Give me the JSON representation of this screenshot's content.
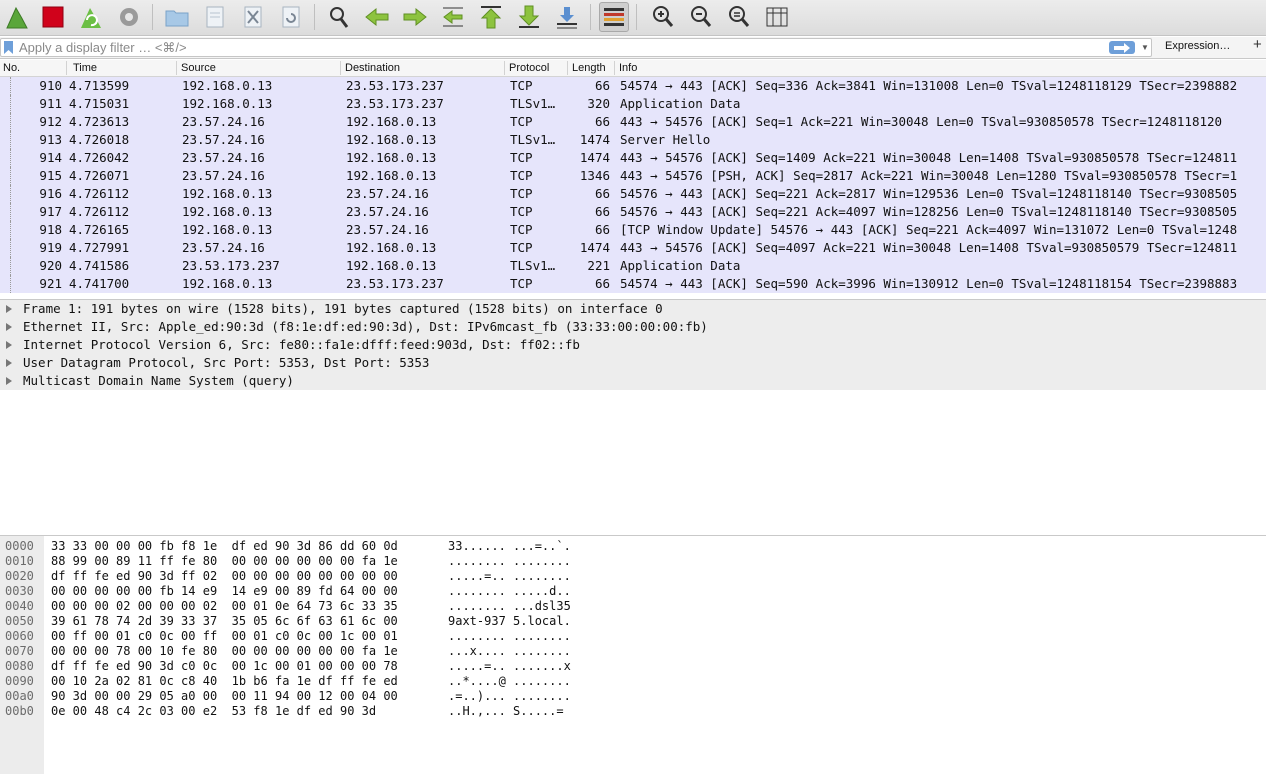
{
  "toolbar": {
    "buttons": [
      {
        "name": "start-capture-fin-icon"
      },
      {
        "name": "stop-capture-icon"
      },
      {
        "name": "restart-capture-icon"
      },
      {
        "name": "capture-options-gear-icon"
      },
      {
        "name": "open-file-folder-icon"
      },
      {
        "name": "save-file-icon"
      },
      {
        "name": "close-file-icon"
      },
      {
        "name": "reload-file-icon"
      },
      {
        "name": "find-packet-magnifier-icon"
      },
      {
        "name": "go-back-arrow-icon"
      },
      {
        "name": "go-forward-arrow-icon"
      },
      {
        "name": "go-to-packet-icon"
      },
      {
        "name": "go-to-first-packet-icon"
      },
      {
        "name": "go-to-last-packet-icon"
      },
      {
        "name": "autoscroll-icon"
      },
      {
        "name": "colorize-icon"
      },
      {
        "name": "zoom-in-icon"
      },
      {
        "name": "zoom-out-icon"
      },
      {
        "name": "normal-size-icon"
      },
      {
        "name": "resize-columns-icon"
      }
    ],
    "colors": {
      "fin": "#5aa63a",
      "stop": "#d0021b",
      "arrow_green": "#8dc33f",
      "zoom": "#3a3a3a"
    }
  },
  "filter": {
    "placeholder": "Apply a display filter … <⌘/>",
    "expression_label": "Expression…",
    "plus_label": "+",
    "apply_color": "#6e9fd9"
  },
  "packet_list": {
    "columns": {
      "no": "No.",
      "time": "Time",
      "source": "Source",
      "destination": "Destination",
      "protocol": "Protocol",
      "length": "Length",
      "info": "Info"
    },
    "row_color": "#e6e5fb",
    "rows": [
      {
        "no": "910",
        "time": "4.713599",
        "src": "192.168.0.13",
        "dst": "23.53.173.237",
        "proto": "TCP",
        "len": "66",
        "info": "54574 → 443 [ACK] Seq=336 Ack=3841 Win=131008 Len=0 TSval=1248118129 TSecr=2398882"
      },
      {
        "no": "911",
        "time": "4.715031",
        "src": "192.168.0.13",
        "dst": "23.53.173.237",
        "proto": "TLSv1…",
        "len": "320",
        "info": "Application Data"
      },
      {
        "no": "912",
        "time": "4.723613",
        "src": "23.57.24.16",
        "dst": "192.168.0.13",
        "proto": "TCP",
        "len": "66",
        "info": "443 → 54576 [ACK] Seq=1 Ack=221 Win=30048 Len=0 TSval=930850578 TSecr=1248118120"
      },
      {
        "no": "913",
        "time": "4.726018",
        "src": "23.57.24.16",
        "dst": "192.168.0.13",
        "proto": "TLSv1…",
        "len": "1474",
        "info": "Server Hello"
      },
      {
        "no": "914",
        "time": "4.726042",
        "src": "23.57.24.16",
        "dst": "192.168.0.13",
        "proto": "TCP",
        "len": "1474",
        "info": "443 → 54576 [ACK] Seq=1409 Ack=221 Win=30048 Len=1408 TSval=930850578 TSecr=124811"
      },
      {
        "no": "915",
        "time": "4.726071",
        "src": "23.57.24.16",
        "dst": "192.168.0.13",
        "proto": "TCP",
        "len": "1346",
        "info": "443 → 54576 [PSH, ACK] Seq=2817 Ack=221 Win=30048 Len=1280 TSval=930850578 TSecr=1"
      },
      {
        "no": "916",
        "time": "4.726112",
        "src": "192.168.0.13",
        "dst": "23.57.24.16",
        "proto": "TCP",
        "len": "66",
        "info": "54576 → 443 [ACK] Seq=221 Ack=2817 Win=129536 Len=0 TSval=1248118140 TSecr=9308505"
      },
      {
        "no": "917",
        "time": "4.726112",
        "src": "192.168.0.13",
        "dst": "23.57.24.16",
        "proto": "TCP",
        "len": "66",
        "info": "54576 → 443 [ACK] Seq=221 Ack=4097 Win=128256 Len=0 TSval=1248118140 TSecr=9308505"
      },
      {
        "no": "918",
        "time": "4.726165",
        "src": "192.168.0.13",
        "dst": "23.57.24.16",
        "proto": "TCP",
        "len": "66",
        "info": "[TCP Window Update] 54576 → 443 [ACK] Seq=221 Ack=4097 Win=131072 Len=0 TSval=1248"
      },
      {
        "no": "919",
        "time": "4.727991",
        "src": "23.57.24.16",
        "dst": "192.168.0.13",
        "proto": "TCP",
        "len": "1474",
        "info": "443 → 54576 [ACK] Seq=4097 Ack=221 Win=30048 Len=1408 TSval=930850579 TSecr=124811"
      },
      {
        "no": "920",
        "time": "4.741586",
        "src": "23.53.173.237",
        "dst": "192.168.0.13",
        "proto": "TLSv1…",
        "len": "221",
        "info": "Application Data"
      },
      {
        "no": "921",
        "time": "4.741700",
        "src": "192.168.0.13",
        "dst": "23.53.173.237",
        "proto": "TCP",
        "len": "66",
        "info": "54574 → 443 [ACK] Seq=590 Ack=3996 Win=130912 Len=0 TSval=1248118154 TSecr=2398883"
      }
    ]
  },
  "details": {
    "rows": [
      "Frame 1: 191 bytes on wire (1528 bits), 191 bytes captured (1528 bits) on interface 0",
      "Ethernet II, Src: Apple_ed:90:3d (f8:1e:df:ed:90:3d), Dst: IPv6mcast_fb (33:33:00:00:00:fb)",
      "Internet Protocol Version 6, Src: fe80::fa1e:dfff:feed:903d, Dst: ff02::fb",
      "User Datagram Protocol, Src Port: 5353, Dst Port: 5353",
      "Multicast Domain Name System (query)"
    ]
  },
  "hex": {
    "rows": [
      {
        "offset": "0000",
        "bytes": "33 33 00 00 00 fb f8 1e  df ed 90 3d 86 dd 60 0d",
        "ascii": "33...... ...=..`."
      },
      {
        "offset": "0010",
        "bytes": "88 99 00 89 11 ff fe 80  00 00 00 00 00 00 fa 1e",
        "ascii": "........ ........"
      },
      {
        "offset": "0020",
        "bytes": "df ff fe ed 90 3d ff 02  00 00 00 00 00 00 00 00",
        "ascii": ".....=.. ........"
      },
      {
        "offset": "0030",
        "bytes": "00 00 00 00 00 fb 14 e9  14 e9 00 89 fd 64 00 00",
        "ascii": "........ .....d.."
      },
      {
        "offset": "0040",
        "bytes": "00 00 00 02 00 00 00 02  00 01 0e 64 73 6c 33 35",
        "ascii": "........ ...dsl35"
      },
      {
        "offset": "0050",
        "bytes": "39 61 78 74 2d 39 33 37  35 05 6c 6f 63 61 6c 00",
        "ascii": "9axt-937 5.local."
      },
      {
        "offset": "0060",
        "bytes": "00 ff 00 01 c0 0c 00 ff  00 01 c0 0c 00 1c 00 01",
        "ascii": "........ ........"
      },
      {
        "offset": "0070",
        "bytes": "00 00 00 78 00 10 fe 80  00 00 00 00 00 00 fa 1e",
        "ascii": "...x.... ........"
      },
      {
        "offset": "0080",
        "bytes": "df ff fe ed 90 3d c0 0c  00 1c 00 01 00 00 00 78",
        "ascii": ".....=.. .......x"
      },
      {
        "offset": "0090",
        "bytes": "00 10 2a 02 81 0c c8 40  1b b6 fa 1e df ff fe ed",
        "ascii": "..*....@ ........"
      },
      {
        "offset": "00a0",
        "bytes": "90 3d 00 00 29 05 a0 00  00 11 94 00 12 00 04 00",
        "ascii": ".=..)... ........"
      },
      {
        "offset": "00b0",
        "bytes": "0e 00 48 c4 2c 03 00 e2  53 f8 1e df ed 90 3d",
        "ascii": "..H.,... S.....="
      }
    ]
  }
}
